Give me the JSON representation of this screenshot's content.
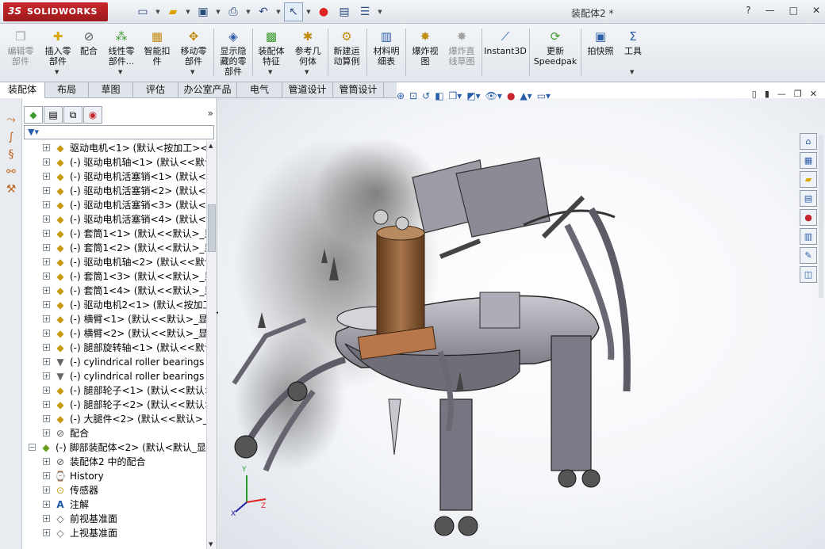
{
  "app": {
    "brand_mark": "3S",
    "brand": "SOLIDWORKS",
    "document_title": "装配体2 *"
  },
  "window_controls": [
    "?",
    "—",
    "□",
    "✕"
  ],
  "ribbon": {
    "buttons": [
      {
        "line1": "编辑零",
        "line2": "部件",
        "icon": "edit-component-icon",
        "enabled": false
      },
      {
        "line1": "插入零",
        "line2": "部件",
        "icon": "insert-component-icon",
        "enabled": true
      },
      {
        "line1": "配合",
        "line2": "",
        "icon": "mate-icon",
        "enabled": true
      },
      {
        "line1": "线性零",
        "line2": "部件...",
        "icon": "linear-pattern-icon",
        "enabled": true
      },
      {
        "line1": "智能扣",
        "line2": "件",
        "icon": "smart-fasteners-icon",
        "enabled": true
      },
      {
        "line1": "移动零",
        "line2": "部件",
        "icon": "move-component-icon",
        "enabled": true
      },
      {
        "line1": "显示隐",
        "line2": "藏的零",
        "line3": "部件",
        "icon": "show-hidden-icon",
        "enabled": true
      },
      {
        "line1": "装配体",
        "line2": "特征",
        "icon": "assembly-features-icon",
        "enabled": true
      },
      {
        "line1": "参考几",
        "line2": "何体",
        "icon": "reference-geometry-icon",
        "enabled": true
      },
      {
        "line1": "新建运",
        "line2": "动算例",
        "icon": "motion-study-icon",
        "enabled": true
      },
      {
        "line1": "材料明",
        "line2": "细表",
        "icon": "bom-icon",
        "enabled": true
      },
      {
        "line1": "爆炸视",
        "line2": "图",
        "icon": "exploded-view-icon",
        "enabled": true
      },
      {
        "line1": "爆炸直",
        "line2": "线草图",
        "icon": "explode-line-sketch-icon",
        "enabled": false
      },
      {
        "line1": "Instant3D",
        "line2": "",
        "icon": "instant3d-icon",
        "enabled": true
      },
      {
        "line1": "更新",
        "line2": "Speedpak",
        "icon": "speedpak-icon",
        "enabled": true
      },
      {
        "line1": "拍快照",
        "line2": "",
        "icon": "snapshot-icon",
        "enabled": true
      },
      {
        "line1": "工具",
        "line2": "",
        "icon": "tools-icon",
        "enabled": true
      }
    ]
  },
  "command_tabs": [
    "装配体",
    "布局",
    "草图",
    "评估",
    "办公室产品",
    "电气",
    "管道设计",
    "管筒设计"
  ],
  "feature_tree": {
    "rows": [
      {
        "label": "驱动电机<1> (默认<按加工><",
        "icon": "part",
        "indent": 1
      },
      {
        "label": "(-) 驱动电机轴<1> (默认<<默认",
        "icon": "part",
        "indent": 1
      },
      {
        "label": "(-) 驱动电机活塞销<1> (默认<",
        "icon": "part",
        "indent": 1
      },
      {
        "label": "(-) 驱动电机活塞销<2> (默认<",
        "icon": "part",
        "indent": 1
      },
      {
        "label": "(-) 驱动电机活塞销<3> (默认<",
        "icon": "part",
        "indent": 1
      },
      {
        "label": "(-) 驱动电机活塞销<4> (默认<",
        "icon": "part",
        "indent": 1
      },
      {
        "label": "(-) 套筒1<1> (默认<<默认>_显",
        "icon": "part",
        "indent": 1
      },
      {
        "label": "(-) 套筒1<2> (默认<<默认>_显",
        "icon": "part",
        "indent": 1
      },
      {
        "label": "(-) 驱动电机轴<2> (默认<<默认",
        "icon": "part",
        "indent": 1
      },
      {
        "label": "(-) 套筒1<3> (默认<<默认>_显",
        "icon": "part",
        "indent": 1
      },
      {
        "label": "(-) 套筒1<4> (默认<<默认>_显",
        "icon": "part",
        "indent": 1
      },
      {
        "label": "(-) 驱动电机2<1> (默认<按加工",
        "icon": "part",
        "indent": 1
      },
      {
        "label": "(-) 横臂<1> (默认<<默认>_显示",
        "icon": "part",
        "indent": 1
      },
      {
        "label": "(-) 横臂<2> (默认<<默认>_显示",
        "icon": "part",
        "indent": 1
      },
      {
        "label": "(-) 腿部旋转轴<1> (默认<<默认>",
        "icon": "part",
        "indent": 1
      },
      {
        "label": "(-) cylindrical roller bearings",
        "icon": "bear",
        "indent": 1
      },
      {
        "label": "(-) cylindrical roller bearings",
        "icon": "bear",
        "indent": 1
      },
      {
        "label": "(-) 腿部轮子<1> (默认<<默认>",
        "icon": "part",
        "indent": 1
      },
      {
        "label": "(-) 腿部轮子<2> (默认<<默认>",
        "icon": "part",
        "indent": 1
      },
      {
        "label": "(-) 大腿件<2> (默认<<默认>_显",
        "icon": "part",
        "indent": 1
      },
      {
        "label": "配合",
        "icon": "mate",
        "indent": 1
      },
      {
        "label": "(-) 脚部装配体<2> (默认<默认_显示",
        "icon": "asm",
        "indent": 0
      },
      {
        "label": "装配体2 中的配合",
        "icon": "mate",
        "indent": 1
      },
      {
        "label": "History",
        "icon": "hist",
        "indent": 1
      },
      {
        "label": "传感器",
        "icon": "sens",
        "indent": 1
      },
      {
        "label": "注解",
        "icon": "note",
        "indent": 1
      },
      {
        "label": "前视基准面",
        "icon": "plane",
        "indent": 1
      },
      {
        "label": "上视基准面",
        "icon": "plane",
        "indent": 1
      }
    ]
  },
  "colors": {
    "titlebar": "#dfe4ea",
    "ribbon": "#e7ebf0",
    "accent": "#2a5ea8",
    "brand_red": "#b52225",
    "part_yellow": "#c79a12",
    "model_body": "#8c8a93",
    "model_bronze": "#8a5a33"
  },
  "triad_labels": {
    "x": "X",
    "y": "Y",
    "z": "Z"
  }
}
